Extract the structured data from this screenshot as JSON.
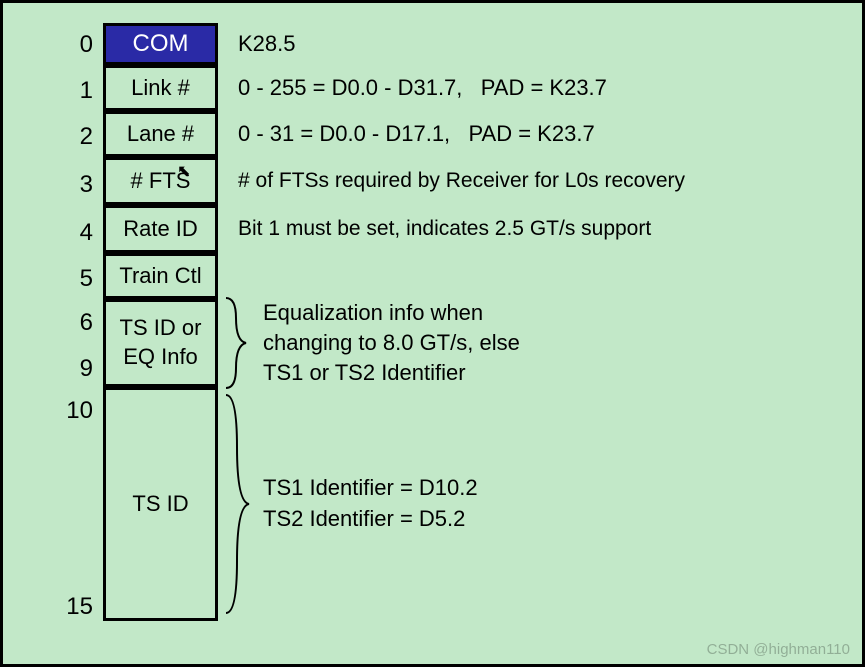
{
  "indices": {
    "r0": "0",
    "r1": "1",
    "r2": "2",
    "r3": "3",
    "r4": "4",
    "r5": "5",
    "r6": "6",
    "r9": "9",
    "r10": "10",
    "r15": "15"
  },
  "boxes": {
    "com": "COM",
    "link": "Link #",
    "lane": "Lane #",
    "fts": "# FTS",
    "rate": "Rate ID",
    "train": "Train Ctl",
    "tsid_eq_l1": "TS ID or",
    "tsid_eq_l2": "EQ Info",
    "tsid": "TS ID"
  },
  "desc": {
    "com": "K28.5",
    "link": "0 - 255 = D0.0 - D31.7,   PAD = K23.7",
    "lane": "0 - 31 = D0.0 - D17.1,   PAD = K23.7",
    "fts": "# of FTSs required by Receiver for L0s recovery",
    "rate": "Bit 1 must be set, indicates 2.5 GT/s support",
    "eq_l1": "Equalization info when",
    "eq_l2": "changing to 8.0 GT/s, else",
    "eq_l3": "TS1 or TS2 Identifier",
    "ts_l1": "TS1 Identifier = D10.2",
    "ts_l2": "TS2 Identifier = D5.2"
  },
  "watermark": "CSDN @highman110"
}
